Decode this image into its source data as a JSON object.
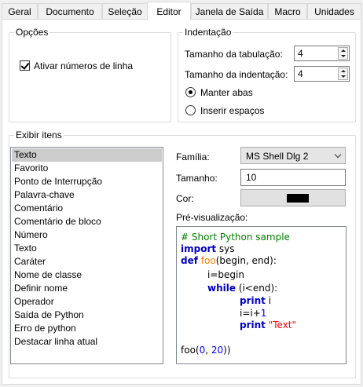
{
  "tabs": [
    "Geral",
    "Documento",
    "Seleção",
    "Editor",
    "Janela de Saída",
    "Macro",
    "Unidades"
  ],
  "active_tab": "Editor",
  "options": {
    "title": "Opções",
    "line_numbers_label": "Ativar números de linha",
    "line_numbers_checked": true
  },
  "indent": {
    "title": "Indentação",
    "tab_size_label": "Tamanho da tabulação:",
    "tab_size_value": "4",
    "indent_size_label": "Tamanho da indentação:",
    "indent_size_value": "4",
    "keep_tabs_label": "Manter abas",
    "insert_spaces_label": "Inserir espaços",
    "selected": "keep_tabs"
  },
  "display": {
    "title": "Exibir itens",
    "items": [
      "Texto",
      "Favorito",
      "Ponto de Interrupção",
      "Palavra-chave",
      "Comentário",
      "Comentário de bloco",
      "Número",
      "Texto",
      "Caráter",
      "Nome de classe",
      "Definir nome",
      "Operador",
      "Saída de Python",
      "Erro de python",
      "Destacar linha atual"
    ],
    "selected_index": 0,
    "family_label": "Família:",
    "family_value": "MS Shell Dlg 2",
    "size_label": "Tamanho:",
    "size_value": "10",
    "color_label": "Cor:",
    "color_value": "#000000",
    "preview_label": "Pré-visualização:"
  },
  "colors": {
    "comment": "#008000",
    "keyword": "#0000c0",
    "operator": "#808080",
    "number": "#0000ff",
    "string": "#ff0000",
    "function": "#ff8000"
  },
  "preview_code": {
    "line1": "# Short Python sample",
    "line2_kw": "import",
    "line2_rest": " sys",
    "line3_kw": "def",
    "line3_fn": " foo",
    "line3_rest": "(begin, end):",
    "line4": "i=begin",
    "line5_kw": "while",
    "line5_rest": " (i<end):",
    "line6_kw": "print",
    "line6_rest": " i",
    "line7_a": "i=i+",
    "line7_num": "1",
    "line8_kw": "print",
    "line8_str": " \"Text\"",
    "line9_a": "foo(",
    "line9_n1": "0",
    "line9_sep": ", ",
    "line9_n2": "20",
    "line9_end": "))"
  }
}
